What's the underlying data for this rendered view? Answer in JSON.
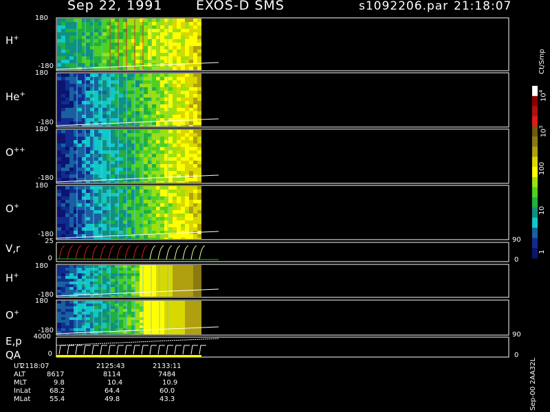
{
  "header": {
    "date": "Sep 22, 1991",
    "instrument": "EXOS-D SMS",
    "file": "s1092206.par",
    "time": "21:18:07"
  },
  "panels": [
    {
      "label": "H",
      "sup": "+",
      "top_tick": "180",
      "bottom_tick": "-180"
    },
    {
      "label": "He",
      "sup": "+",
      "top_tick": "180",
      "bottom_tick": "-180"
    },
    {
      "label": "O",
      "sup": "++",
      "top_tick": "180",
      "bottom_tick": "-180"
    },
    {
      "label": "O",
      "sup": "+",
      "top_tick": "180",
      "bottom_tick": "-180"
    },
    {
      "label": "V,r",
      "sup": "",
      "top_tick": "25",
      "bottom_tick": "0",
      "right_top": "90",
      "right_bottom": "0"
    },
    {
      "label": "H",
      "sup": "+",
      "top_tick": "180",
      "bottom_tick": "-180"
    },
    {
      "label": "O",
      "sup": "+",
      "top_tick": "180",
      "bottom_tick": "-180"
    },
    {
      "label": "E,p",
      "sup": "",
      "label2": "QA",
      "top_tick": "4000",
      "bottom_tick": "0",
      "right_top": "90",
      "right_bottom": "0"
    }
  ],
  "colorbar": {
    "unit": "Ct/Smp",
    "ticks": [
      "10",
      "10",
      "100",
      "10",
      "1"
    ],
    "exps": [
      "4",
      "3",
      "",
      "",
      ""
    ],
    "colors": [
      "#ffffff",
      "#8b0000",
      "#b01010",
      "#e01818",
      "#6b5a10",
      "#8a7a10",
      "#b0a010",
      "#d8d800",
      "#ffff00",
      "#9ce010",
      "#50d020",
      "#20b040",
      "#109080",
      "#10c8c8",
      "#1860a0",
      "#102c90",
      "#0c1470"
    ]
  },
  "footer": {
    "labels": [
      "UT",
      "ALT",
      "MLT",
      "InLat",
      "MLat"
    ],
    "columns": [
      [
        "2118:07",
        "8617",
        "9.8",
        "68.2",
        "55.4"
      ],
      [
        "2125:43",
        "8114",
        "10.4",
        "64.4",
        "49.8"
      ],
      [
        "2133:11",
        "7484",
        "10.9",
        "60.0",
        "43.3"
      ]
    ],
    "side_label": "Sep-00  2AA32L"
  },
  "chart_data": {
    "type": "heatmap",
    "title": "Sep 22, 1991   EXOS-D SMS",
    "x": [
      "2118:07",
      "2125:43",
      "2133:11"
    ],
    "colorbar_unit": "Ct/Smp",
    "colorbar_ticks": [
      "10^4",
      "10^3",
      "100",
      "10",
      "1"
    ],
    "panels": [
      "H+",
      "He+",
      "O++",
      "O+",
      "V,r",
      "H+",
      "O+",
      "E,p QA"
    ],
    "ylim_pitch": [
      -180,
      180
    ],
    "ylim_vr": [
      0,
      25
    ],
    "ylim_ep": [
      0,
      4000
    ]
  }
}
